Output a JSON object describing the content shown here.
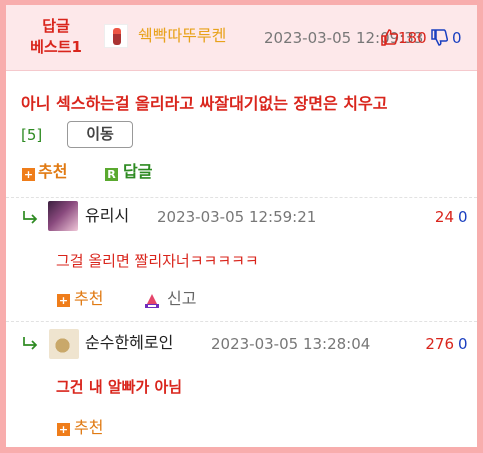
{
  "header": {
    "badge_line1": "답글",
    "badge_line2": "베스트1",
    "author": "쉑빡따뚜루켄",
    "date": "2023-03-05 12:09:33",
    "upvotes": "180",
    "downvotes": "0"
  },
  "post": {
    "title": "아니 섹스하는걸 올리라고 싸잘대기없는 장면은 치우고",
    "count": "[5]",
    "move_label": "이동",
    "recommend_label": "추천",
    "reply_label": "답글",
    "recommend_icon": "+",
    "reply_icon": "R"
  },
  "replies": [
    {
      "author": "유리시",
      "date": "2023-03-05 12:59:21",
      "upvotes": "24",
      "downvotes": "0",
      "text": "그걸 올리면 짤리자너ㅋㅋㅋㅋㅋ",
      "recommend_label": "추천",
      "report_label": "신고"
    },
    {
      "author": "순수한헤로인",
      "date": "2023-03-05 13:28:04",
      "upvotes": "276",
      "downvotes": "0",
      "text": "그건 내 알빠가 아님",
      "recommend_label": "추천"
    }
  ],
  "colors": {
    "accent_red": "#d9251c",
    "header_bg": "#fde8ea",
    "frame": "#f8adad",
    "author_orange": "#e8a21b",
    "green": "#2e8b22",
    "blue": "#1a3fc0"
  },
  "icons": {
    "thumbs_up": "thumbs-up-icon",
    "thumbs_down": "thumbs-down-icon",
    "reply_arrow": "reply-arrow-icon",
    "report": "report-icon"
  }
}
